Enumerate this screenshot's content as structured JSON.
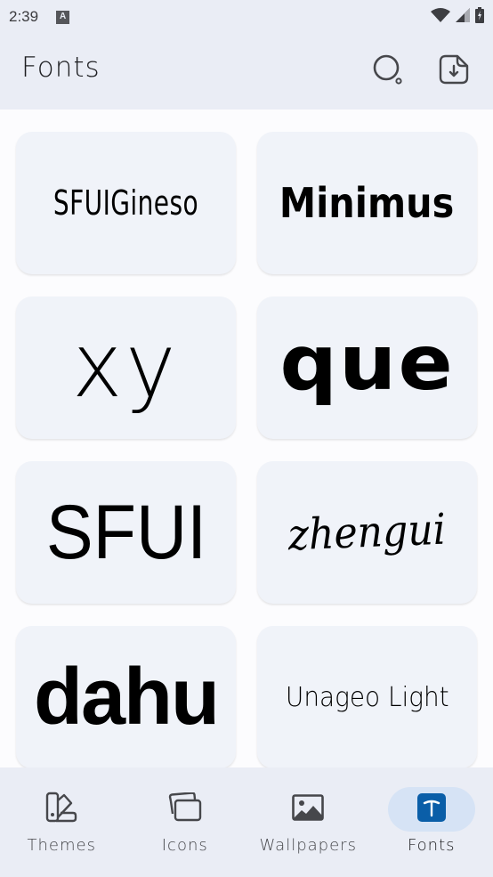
{
  "status_bar": {
    "time": "2:39",
    "notification_icon": "keyboard-a-icon",
    "icons": [
      "wifi-icon",
      "cell-signal-icon",
      "battery-charging-icon"
    ]
  },
  "header": {
    "title": "Fonts",
    "actions": [
      {
        "name": "search",
        "icon": "search-icon"
      },
      {
        "name": "downloads",
        "icon": "download-file-icon"
      }
    ]
  },
  "fonts": [
    {
      "label": "SFUIGineso"
    },
    {
      "label": "Minimus"
    },
    {
      "label": "xy"
    },
    {
      "label": "que"
    },
    {
      "label": "SFUI"
    },
    {
      "label": "zhengui"
    },
    {
      "label": "dahu"
    },
    {
      "label": "Unageo Light"
    }
  ],
  "bottom_nav": {
    "items": [
      {
        "label": "Themes",
        "icon": "palette-swatch-icon",
        "active": false
      },
      {
        "label": "Icons",
        "icon": "stacked-cards-icon",
        "active": false
      },
      {
        "label": "Wallpapers",
        "icon": "image-icon",
        "active": false
      },
      {
        "label": "Fonts",
        "icon": "font-t-icon",
        "active": true
      }
    ]
  },
  "colors": {
    "header_bg": "#eaedf5",
    "card_bg": "#f0f3f9",
    "active_pill": "#d6e3f5",
    "accent": "#0a5ea8"
  }
}
